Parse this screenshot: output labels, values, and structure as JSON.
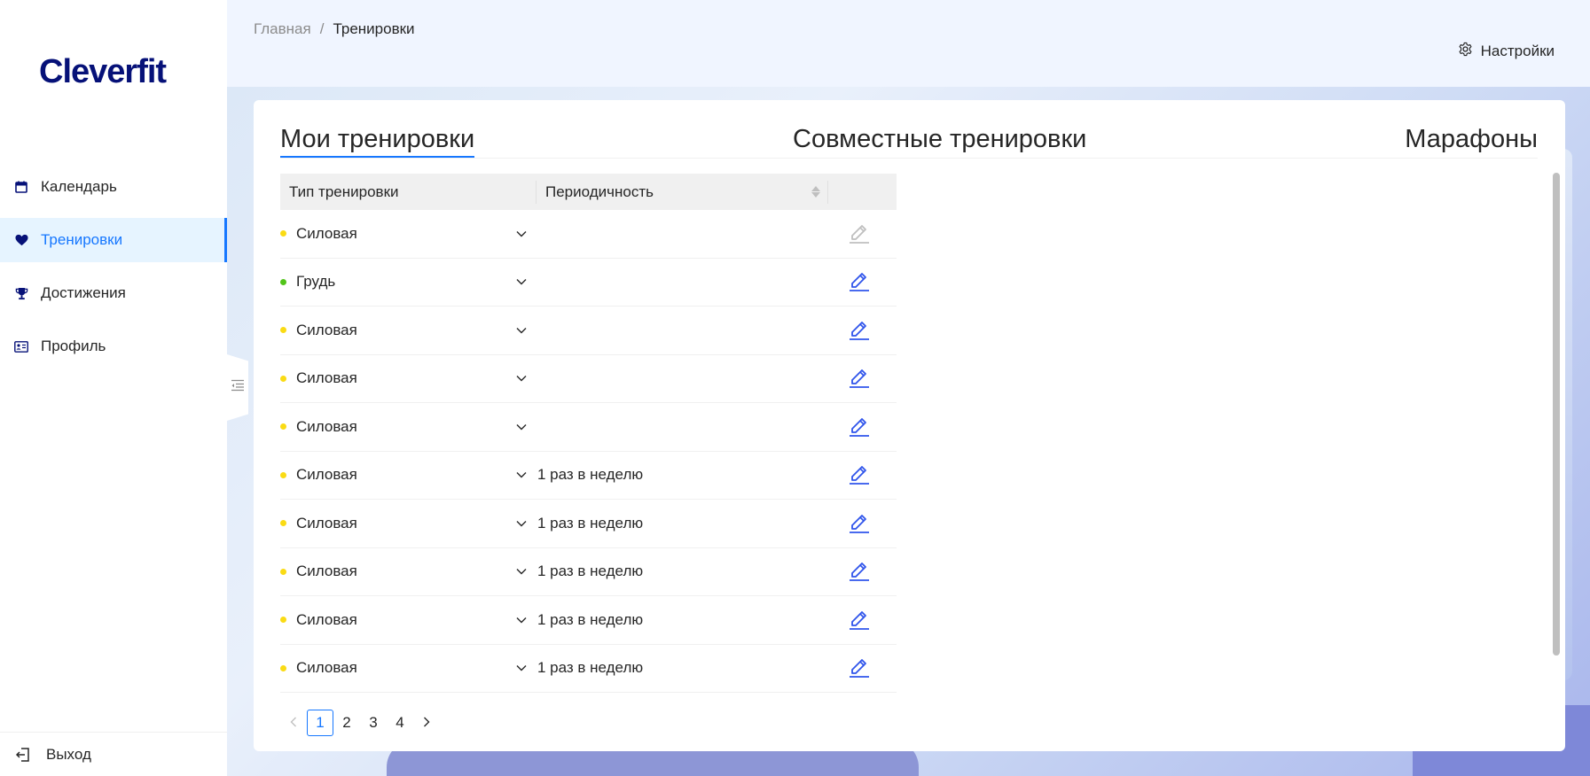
{
  "sidebar": {
    "logo": "Cleverfit",
    "items": [
      {
        "label": "Календарь",
        "icon": "calendar-icon"
      },
      {
        "label": "Тренировки",
        "icon": "heart-icon",
        "active": true
      },
      {
        "label": "Достижения",
        "icon": "trophy-icon"
      },
      {
        "label": "Профиль",
        "icon": "idcard-icon"
      }
    ],
    "exit_label": "Выход"
  },
  "header": {
    "breadcrumb": [
      "Главная",
      "Тренировки"
    ],
    "breadcrumb_sep": "/",
    "settings_label": "Настройки"
  },
  "tabs": [
    "Мои тренировки",
    "Совместные тренировки",
    "Марафоны"
  ],
  "table": {
    "columns": [
      "Тип тренировки",
      "Периодичность",
      ""
    ],
    "rows": [
      {
        "type": "Силовая",
        "period": "",
        "dot": "#fadb14",
        "edit_disabled": true
      },
      {
        "type": "Грудь",
        "period": "",
        "dot": "#52c41a",
        "edit_disabled": false
      },
      {
        "type": "Силовая",
        "period": "",
        "dot": "#fadb14",
        "edit_disabled": false
      },
      {
        "type": "Силовая",
        "period": "",
        "dot": "#fadb14",
        "edit_disabled": false
      },
      {
        "type": "Силовая",
        "period": "",
        "dot": "#fadb14",
        "edit_disabled": false
      },
      {
        "type": "Силовая",
        "period": "1 раз в неделю",
        "dot": "#fadb14",
        "edit_disabled": false
      },
      {
        "type": "Силовая",
        "period": "1 раз в неделю",
        "dot": "#fadb14",
        "edit_disabled": false
      },
      {
        "type": "Силовая",
        "period": "1 раз в неделю",
        "dot": "#fadb14",
        "edit_disabled": false
      },
      {
        "type": "Силовая",
        "period": "1 раз в неделю",
        "dot": "#fadb14",
        "edit_disabled": false
      },
      {
        "type": "Силовая",
        "period": "1 раз в неделю",
        "dot": "#fadb14",
        "edit_disabled": false
      }
    ]
  },
  "pagination": {
    "pages": [
      "1",
      "2",
      "3",
      "4"
    ],
    "current": "1"
  },
  "colors": {
    "brand": "#061178",
    "accent": "#1677ff",
    "edit_icon": "#2f54eb",
    "disabled": "#bfbfbf"
  }
}
